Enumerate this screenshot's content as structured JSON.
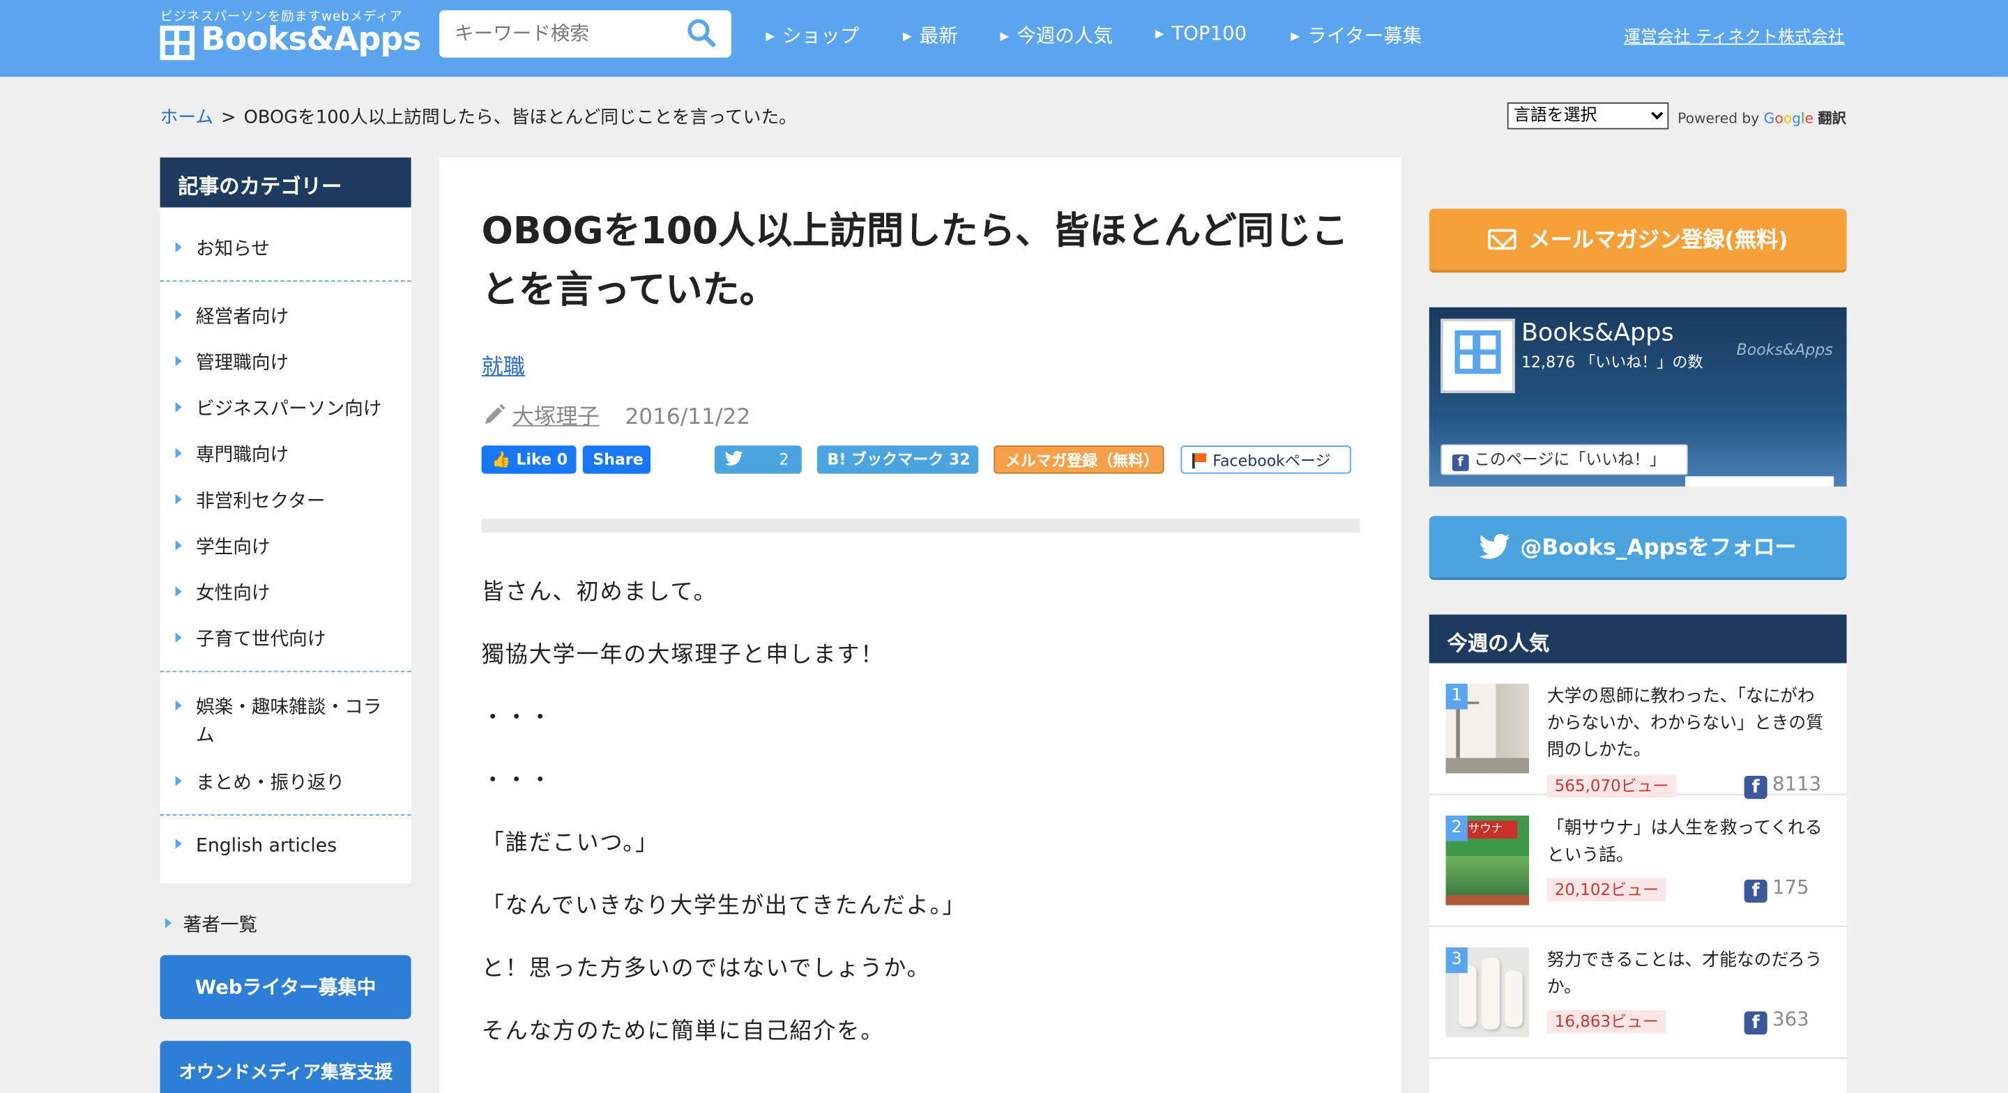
{
  "header": {
    "tagline": "ビジネスパーソンを励ますwebメディア",
    "logo_text": "Books&Apps",
    "search_placeholder": "キーワード検索",
    "nav": [
      "ショップ",
      "最新",
      "今週の人気",
      "TOP100",
      "ライター募集"
    ],
    "company_link": "運営会社 ティネクト株式会社",
    "brand_color": "#5aa5ee"
  },
  "breadcrumb": {
    "home": "ホーム",
    "separator": ">",
    "current": "OBOGを100人以上訪問したら、皆ほとんど同じことを言っていた。"
  },
  "translate": {
    "select_value": "言語を選択",
    "powered_by": "Powered by",
    "google": [
      "G",
      "o",
      "o",
      "g",
      "l",
      "e"
    ],
    "translate_label": "翻訳"
  },
  "sidebar": {
    "heading": "記事のカテゴリー",
    "group1": [
      "お知らせ"
    ],
    "group2": [
      "経営者向け",
      "管理職向け",
      "ビジネスパーソン向け",
      "専門職向け",
      "非営利セクター",
      "学生向け",
      "女性向け",
      "子育て世代向け"
    ],
    "group3_line1": "娯楽・趣味雑談・コラ",
    "group3_line2": "ム",
    "group3_item2": "まとめ・振り返り",
    "group4": [
      "English articles"
    ],
    "authors": "著者一覧",
    "writer_button": "Webライター募集中",
    "owned_button": "オウンドメディア集客支援"
  },
  "article": {
    "title": "OBOGを100人以上訪問したら、皆ほとんど同じことを言っていた。",
    "category": "就職",
    "author": "大塚理子",
    "date": "2016/11/22",
    "share": {
      "fb_like": "Like 0",
      "fb_share": "Share",
      "tweet_count": "2",
      "hatena": "B! ブックマーク 32",
      "mailmag": "メルマガ登録（無料）",
      "fb_page": "Facebookページ"
    },
    "paragraphs": [
      "皆さん、初めまして。",
      "獨協大学一年の大塚理子と申します！",
      "・・・",
      "・・・",
      "「誰だこいつ。」",
      "「なんでいきなり大学生が出てきたんだよ。」",
      "と！思った方多いのではないでしょうか。",
      "そんな方のために簡単に自己紹介を。"
    ]
  },
  "right": {
    "mail_button": "メールマガジン登録(無料)",
    "fb_widget": {
      "name": "Books&Apps",
      "count": "12,876 「いいね！」の数",
      "brand": "Books&Apps",
      "like_button": "このページに「いいね！」"
    },
    "twitter_button": "@Books_Appsをフォロー",
    "popular_heading": "今週の人気",
    "popular": [
      {
        "rank": "1",
        "title": "大学の恩師に教わった、「なにがわからないか、わからない」ときの質問のしかた。",
        "views": "565,070ビュー",
        "likes": "8113"
      },
      {
        "rank": "2",
        "title": "「朝サウナ」は人生を救ってくれるという話。",
        "views": "20,102ビュー",
        "likes": "175"
      },
      {
        "rank": "3",
        "title": "努力できることは、才能なのだろうか。",
        "views": "16,863ビュー",
        "likes": "363"
      }
    ]
  }
}
